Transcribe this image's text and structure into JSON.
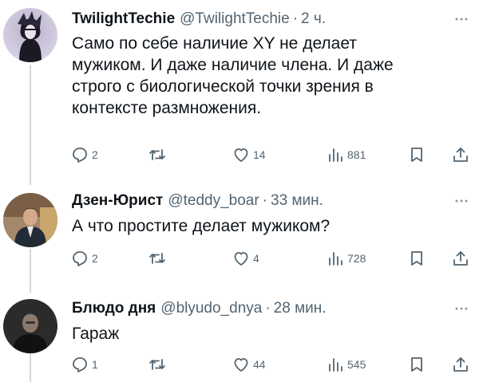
{
  "tweets": [
    {
      "display_name": "TwilightTechie",
      "handle": "@TwilightTechie",
      "separator": "·",
      "time": "2 ч.",
      "lines": [
        "Само по себе наличие XY не делает",
        "мужиком. И даже наличие члена. И даже",
        "строго с биологической точки зрения в",
        "контексте размножения."
      ],
      "replies": "2",
      "retweets": "",
      "likes": "14",
      "views": "881",
      "avatar_icon": "dark-anime-figure-avatar"
    },
    {
      "display_name": "Дзен-Юрист",
      "handle": "@teddy_boar",
      "separator": "·",
      "time": "33 мин.",
      "lines": [
        "А что простите делает мужиком?"
      ],
      "replies": "2",
      "retweets": "",
      "likes": "4",
      "views": "728",
      "avatar_icon": "man-in-suit-avatar"
    },
    {
      "display_name": "Блюдо дня",
      "handle": "@blyudo_dnya",
      "separator": "·",
      "time": "28 мин.",
      "lines": [
        "Гараж"
      ],
      "replies": "1",
      "retweets": "",
      "likes": "44",
      "views": "545",
      "avatar_icon": "man-dark-background-avatar"
    }
  ],
  "colors": {
    "text": "#0f1419",
    "secondary": "#536471",
    "thread_line": "#cfd9de"
  }
}
